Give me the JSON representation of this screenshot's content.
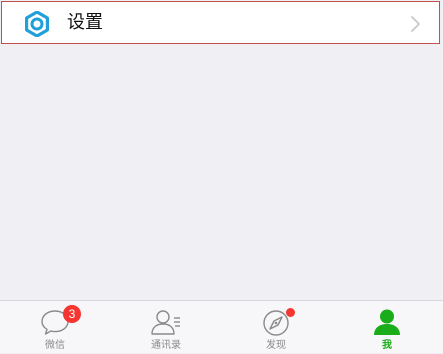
{
  "settings": {
    "label": "设置",
    "icon": "gear-icon",
    "chevron_icon": "chevron-right-icon"
  },
  "tabbar": {
    "tabs": [
      {
        "label": "微信",
        "icon": "chat-bubble-icon",
        "badge": "3"
      },
      {
        "label": "通讯录",
        "icon": "contacts-icon"
      },
      {
        "label": "发现",
        "icon": "compass-icon",
        "has_dot": true
      },
      {
        "label": "我",
        "icon": "person-icon",
        "active": true
      }
    ]
  },
  "colors": {
    "accent": "#1aad19",
    "badge": "#f43530",
    "settings_icon": "#20a0da",
    "row_outline": "#c0504d",
    "background": "#efeff4"
  }
}
